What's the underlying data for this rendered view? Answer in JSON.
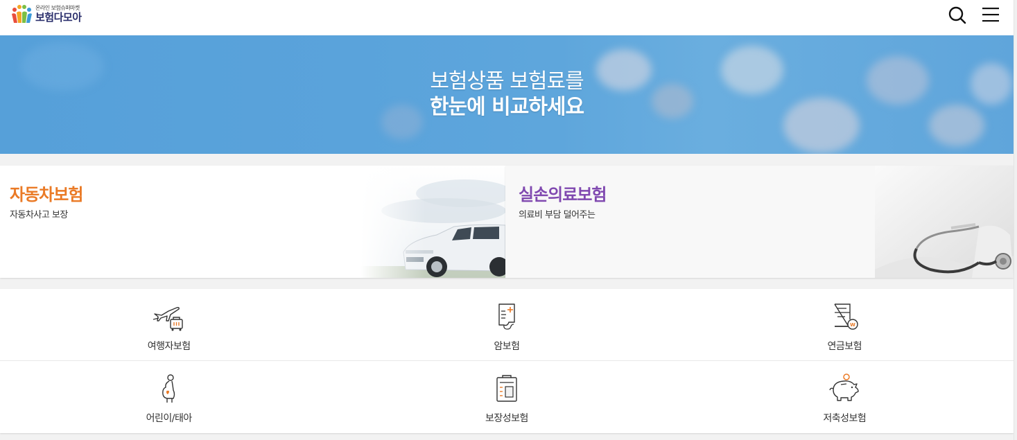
{
  "header": {
    "logo_sub": "온라인 보험슈퍼마켓",
    "logo_main": "보험다모아",
    "search_icon": "search-icon",
    "menu_icon": "hamburger-menu-icon"
  },
  "banner": {
    "line1": "보험상품 보험료를",
    "line2": "한눈에 비교하세요"
  },
  "cards": [
    {
      "title": "자동차보험",
      "desc": "자동차사고 보장",
      "color": "#ea7a26",
      "image": "car-image"
    },
    {
      "title": "실손의료보험",
      "desc": "의료비 부담 덜어주는",
      "color": "#8049b0",
      "image": "stethoscope-image"
    }
  ],
  "grid": [
    {
      "label": "여행자보험",
      "icon": "airplane-luggage-icon"
    },
    {
      "label": "암보험",
      "icon": "medical-document-icon"
    },
    {
      "label": "연금보험",
      "icon": "pension-document-icon"
    },
    {
      "label": "어린이/태아",
      "icon": "pregnant-woman-icon"
    },
    {
      "label": "보장성보험",
      "icon": "clipboard-icon"
    },
    {
      "label": "저축성보험",
      "icon": "piggy-bank-icon"
    }
  ],
  "colors": {
    "accent_orange": "#ea7a26",
    "accent_purple": "#8049b0",
    "banner_blue": "#5aa3db",
    "logo_navy": "#2a2e6b"
  }
}
